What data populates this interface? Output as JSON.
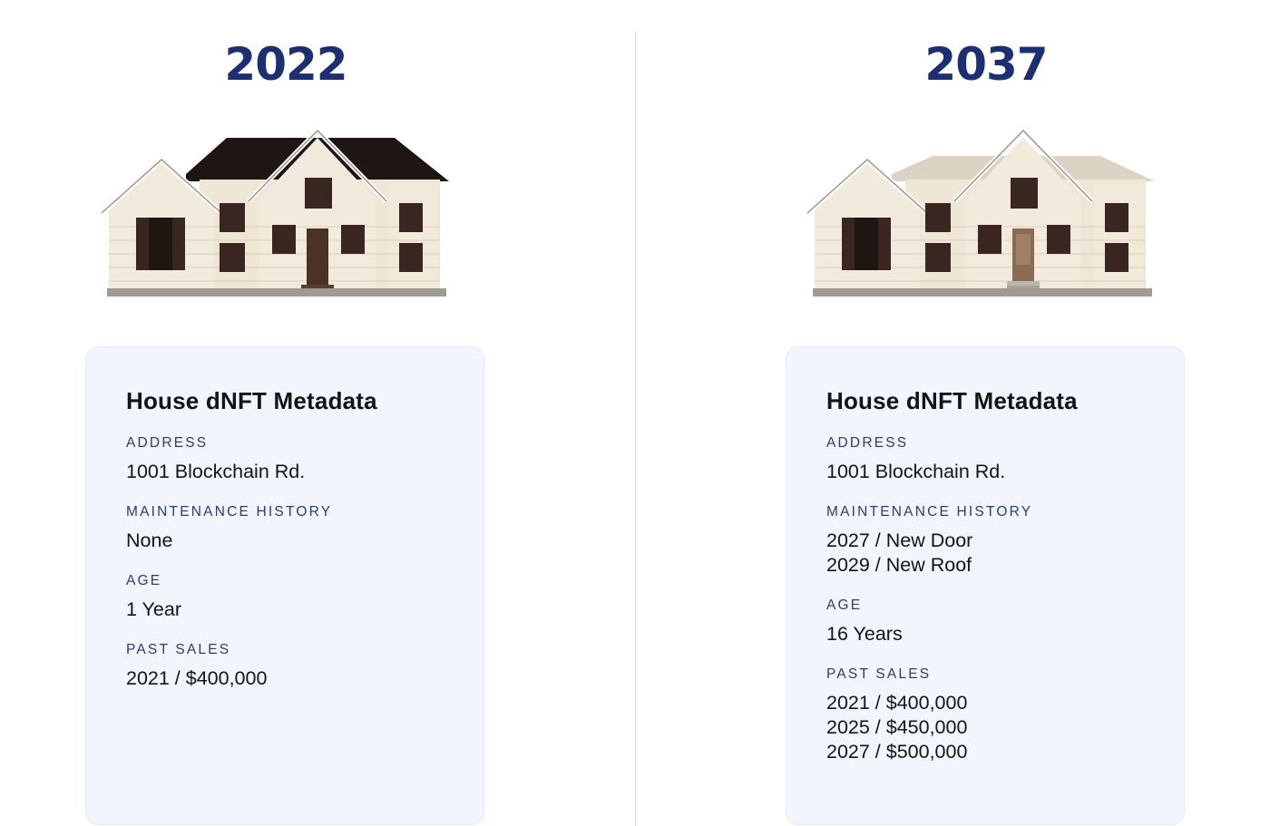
{
  "left": {
    "year": "2022",
    "card": {
      "title": "House dNFT Metadata",
      "address_label": "ADDRESS",
      "address": "1001 Blockchain Rd.",
      "maintenance_label": "MAINTENANCE HISTORY",
      "maintenance": [
        "None"
      ],
      "age_label": "AGE",
      "age": "1 Year",
      "sales_label": "PAST SALES",
      "sales": [
        "2021 / $400,000"
      ]
    },
    "house": {
      "roof_color": "#1e1514",
      "icon": "house-icon"
    }
  },
  "right": {
    "year": "2037",
    "card": {
      "title": "House dNFT Metadata",
      "address_label": "ADDRESS",
      "address": "1001 Blockchain Rd.",
      "maintenance_label": "MAINTENANCE HISTORY",
      "maintenance": [
        "2027 / New Door",
        "2029 / New Roof"
      ],
      "age_label": "AGE",
      "age": "16 Years",
      "sales_label": "PAST SALES",
      "sales": [
        "2021 / $400,000",
        "2025 / $450,000",
        "2027 / $500,000"
      ]
    },
    "house": {
      "roof_color": "#ddd3c4",
      "icon": "house-icon"
    }
  },
  "colors": {
    "year": "#1b2f72",
    "label": "#2b3a78",
    "card_bg": "#f2f5fd",
    "siding": "#efe6d6",
    "shutter": "#3a2620"
  }
}
